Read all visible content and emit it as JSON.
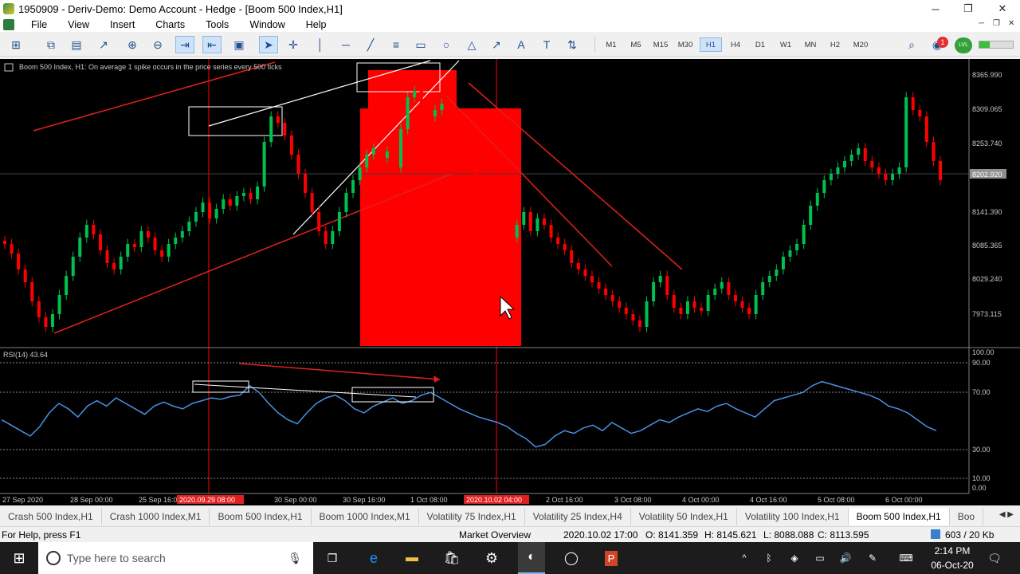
{
  "window": {
    "title": "1950909 - Deriv-Demo: Demo Account - Hedge - [Boom 500 Index,H1]",
    "minimize": "─",
    "maximize": "❐",
    "close": "✕"
  },
  "menu": [
    "File",
    "View",
    "Insert",
    "Charts",
    "Tools",
    "Window",
    "Help"
  ],
  "timeframes": [
    "M1",
    "M5",
    "M15",
    "M30",
    "H1",
    "H4",
    "D1",
    "W1",
    "MN",
    "H2",
    "M20"
  ],
  "active_timeframe": "H1",
  "toolbar": {
    "notification_count": "1",
    "account_badge": "LVL"
  },
  "chart": {
    "header": "Boom 500 Index, H1:  On average 1 spike occurs in the price series every 500 ticks",
    "price_labels": [
      "8365.990",
      "8309.065",
      "8253.740",
      "8202.920",
      "8141.390",
      "8085.365",
      "8029.240",
      "7973.115"
    ],
    "current_price": "8202.920",
    "rsi_label": "RSI(14) 43.64",
    "rsi_levels": [
      "100.00",
      "90.00",
      "70.00",
      "30.00",
      "10.00",
      "0.00"
    ],
    "time_labels": [
      "27 Sep 2020",
      "28 Sep 00:00",
      "25 Sep 16:00",
      "30 Sep 00:00",
      "30 Sep 16:00",
      "1 Oct 08:00",
      "2 Oct 16:00",
      "3 Oct 08:00",
      "4 Oct 00:00",
      "4 Oct 16:00",
      "5 Oct 08:00",
      "6 Oct 00:00"
    ],
    "crosshair_times": [
      "2020.09.29 08:00",
      "2020.10.02 04:00"
    ],
    "colors": {
      "bull": "#00c050",
      "bear": "#ff0000",
      "rsi": "#4a90e2",
      "zone": "#ff0000",
      "background": "#000000"
    }
  },
  "chart_data": {
    "type": "candlestick",
    "y_range": [
      7950,
      8380
    ],
    "closes": [
      8100,
      8085,
      8060,
      8040,
      8010,
      7985,
      7970,
      7990,
      8020,
      8050,
      8080,
      8110,
      8130,
      8115,
      8090,
      8070,
      8060,
      8080,
      8100,
      8095,
      8120,
      8110,
      8090,
      8080,
      8100,
      8110,
      8120,
      8135,
      8150,
      8165,
      8140,
      8155,
      8170,
      8160,
      8175,
      8180,
      8170,
      8190,
      8260,
      8300,
      8290,
      8270,
      8240,
      8210,
      8180,
      8150,
      8120,
      8100,
      8120,
      8150,
      8180,
      8200,
      8220,
      8240,
      8250,
      8235,
      8245,
      8220,
      8280,
      8330,
      8340,
      8320,
      8300,
      8310,
      8320,
      8300,
      8280,
      8270,
      8220,
      8190,
      8160,
      8140,
      8130,
      8120,
      8110,
      8130,
      8150,
      8120,
      8140,
      8130,
      8110,
      8100,
      8090,
      8070,
      8060,
      8050,
      8040,
      8030,
      8020,
      8010,
      8000,
      7990,
      7980,
      7970,
      8010,
      8040,
      8050,
      8020,
      8000,
      7990,
      8010,
      8000,
      7995,
      8020,
      8030,
      8040,
      8020,
      8010,
      8000,
      7990,
      8020,
      8040,
      8050,
      8060,
      8080,
      8090,
      8100,
      8130,
      8160,
      8180,
      8200,
      8210,
      8220,
      8230,
      8240,
      8250,
      8230,
      8220,
      8210,
      8200,
      8210,
      8220,
      8330,
      8310,
      8300,
      8260,
      8230,
      8200
    ],
    "rsi": [
      50,
      46,
      42,
      38,
      45,
      55,
      62,
      58,
      52,
      60,
      64,
      60,
      66,
      62,
      58,
      54,
      60,
      63,
      60,
      58,
      62,
      64,
      66,
      65,
      67,
      68,
      75,
      70,
      62,
      55,
      50,
      47,
      55,
      62,
      66,
      68,
      64,
      58,
      55,
      60,
      63,
      66,
      62,
      64,
      68,
      70,
      66,
      62,
      58,
      55,
      52,
      50,
      48,
      45,
      40,
      36,
      30,
      32,
      38,
      42,
      40,
      44,
      46,
      42,
      48,
      44,
      40,
      42,
      46,
      50,
      48,
      52,
      55,
      58,
      56,
      60,
      62,
      58,
      55,
      52,
      58,
      64,
      66,
      68,
      70,
      75,
      78,
      76,
      74,
      72,
      70,
      68,
      65,
      60,
      58,
      55,
      50,
      45,
      42
    ]
  },
  "tabs": [
    "Crash 500 Index,H1",
    "Crash 1000 Index,M1",
    "Boom 500 Index,H1",
    "Boom 1000 Index,M1",
    "Volatility 75 Index,H1",
    "Volatility 25 Index,H4",
    "Volatility 50 Index,H1",
    "Volatility 100 Index,H1",
    "Boom 500 Index,H1",
    "Boo"
  ],
  "active_tab_index": 8,
  "status": {
    "help": "For Help, press F1",
    "profile": "Market Overview",
    "datetime": "2020.10.02 17:00",
    "open": "O: 8141.359",
    "high": "H: 8145.621",
    "low": "L: 8088.088",
    "close": "C: 8113.595",
    "traffic": "603 / 20 Kb"
  },
  "taskbar": {
    "search_placeholder": "Type here to search",
    "time": "2:14 PM",
    "date": "06-Oct-20"
  }
}
